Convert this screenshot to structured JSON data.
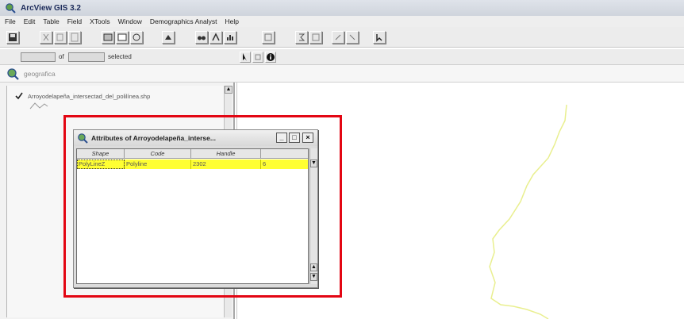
{
  "app": {
    "title": "ArcView GIS 3.2"
  },
  "menu": [
    "File",
    "Edit",
    "Table",
    "Field",
    "XTools",
    "Window",
    "Demographics Analyst",
    "Help"
  ],
  "selection": {
    "of_label": "of",
    "selected_label": "selected"
  },
  "view": {
    "title": "geografica"
  },
  "toc": {
    "theme_label": "Arroyodelapeña_intersectad_del_polilínea.shp"
  },
  "attribute_window": {
    "title": "Attributes of Arroyodelapeña_interse...",
    "columns": [
      "Shape",
      "Code",
      "Handle",
      ""
    ],
    "rows": [
      {
        "shape": "PolyLineZ",
        "code": "Polyline",
        "handle": "2302",
        "extra": "6"
      }
    ]
  },
  "colors": {
    "highlight": "#ffff33",
    "annotation_box": "#e30613",
    "feature_line": "#e9ef8f"
  }
}
